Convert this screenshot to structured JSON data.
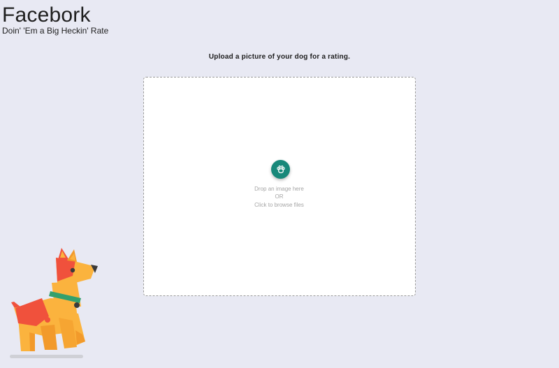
{
  "header": {
    "title": "Facebork",
    "tagline": "Doin' 'Em a Big Heckin' Rate"
  },
  "main": {
    "instruction": "Upload a picture of your dog for a rating."
  },
  "dropzone": {
    "upload_icon": "paw-icon",
    "line1": "Drop an image here",
    "line2": "OR",
    "line3": "Click to browse files"
  },
  "illustration": {
    "icon": "dog-illustration"
  },
  "colors": {
    "background": "#e8e9f3",
    "accent": "#18887a",
    "dog_body": "#fbb33e",
    "dog_patch": "#f0513c",
    "dog_collar": "#33a06d"
  }
}
